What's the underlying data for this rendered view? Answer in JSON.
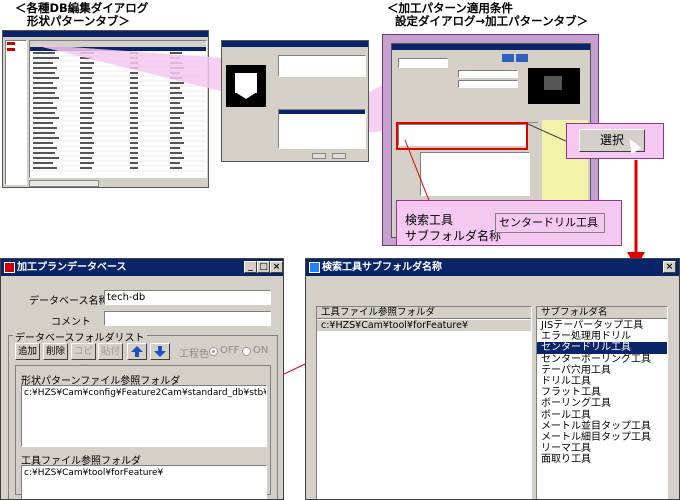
{
  "captions": {
    "top_left": "＜各種DB編集ダイアログ\n   形状パターンタブ＞",
    "top_right": "＜加工パターン適用条件\n  設定ダイアログ→加工パターンタブ＞"
  },
  "callouts": {
    "select_button": "選択",
    "search_tool_label": "検索工具",
    "subfolder_name_label": "サブフォルダ名称",
    "subfolder_value": "センタードリル工具"
  },
  "colors": {
    "pink_panel": "#f4c8f0",
    "callout_border": "#8a3a8a",
    "arrow_red": "#e00000",
    "selection": "#0a246a",
    "titlebar": "#0a246a"
  },
  "db_window": {
    "title": "加工プランデータベース",
    "title_buttons": [
      "_",
      "□",
      "×"
    ],
    "db_name_label": "データベース名称",
    "db_name_value": "tech-db",
    "comment_label": "コメント",
    "comment_value": "",
    "group_label": "データベースフォルダリスト",
    "toolbar": {
      "add": "追加",
      "delete": "削除",
      "copy": "コピー",
      "paste": "貼付",
      "up_icon": "arrow-up-icon",
      "down_icon": "arrow-down-icon",
      "process_color_label": "工程色",
      "radio_off": "OFF",
      "radio_on": "ON"
    },
    "shape_pattern_folder_label": "形状パターンファイル参照フォルダ",
    "shape_pattern_folder_value": "c:¥HZS¥Cam¥config¥Feature2Cam¥standard_db¥stb¥",
    "tool_folder_label": "工具ファイル参照フォルダ",
    "tool_folder_value": "c:¥HZS¥Cam¥tool¥forFeature¥"
  },
  "subfolder_window": {
    "title": "検索工具サブフォルダ名称",
    "title_button": "×",
    "left_header": "工具ファイル参照フォルダ",
    "left_value": "c:¥HZS¥Cam¥tool¥forFeature¥",
    "right_header": "サブフォルダ名",
    "items": [
      "JISテーパータップ工具",
      "エラー処理用ドリル",
      "センタードリル工具",
      "センターボーリング工具",
      "テーパ穴用工具",
      "ドリル工具",
      "フラット工具",
      "ボーリング工具",
      "ボール工具",
      "メートル並目タップ工具",
      "メートル細目タップ工具",
      "リーマ工具",
      "面取り工具"
    ],
    "selected_index": 2
  }
}
